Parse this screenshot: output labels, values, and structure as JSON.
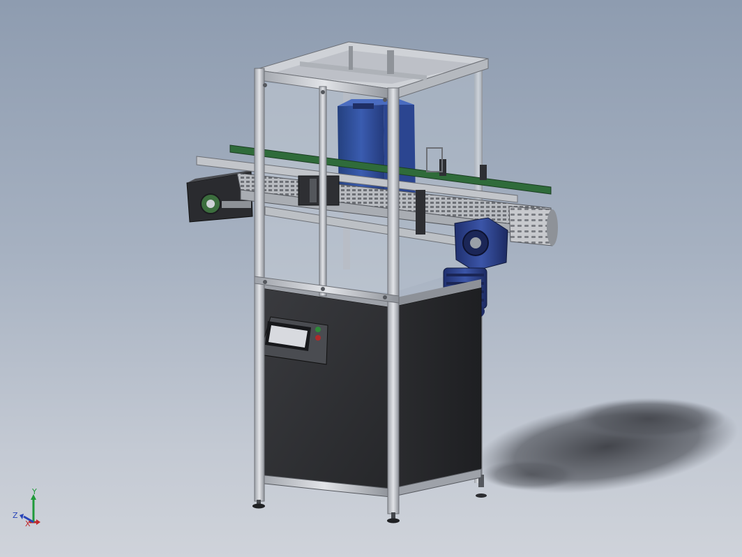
{
  "viewport": {
    "background_top": "#8e9cb0",
    "background_bottom": "#cfd3da"
  },
  "model": {
    "frame_color": "#c9ccd2",
    "panel_color": "#2d2e31",
    "glass_color": "#b9c3cf",
    "conveyor_color": "#bfc3c8",
    "motor_color": "#2a3e8c",
    "bottle_color": "#2f4c9e",
    "guide_rail_color": "#2f6b3a",
    "hmi_screen_color": "#d8dadf"
  },
  "triad": {
    "x_label": "X",
    "y_label": "Y",
    "z_label": "Z",
    "x_color": "#c0282d",
    "y_color": "#1f9a3a",
    "z_color": "#2844b8"
  }
}
